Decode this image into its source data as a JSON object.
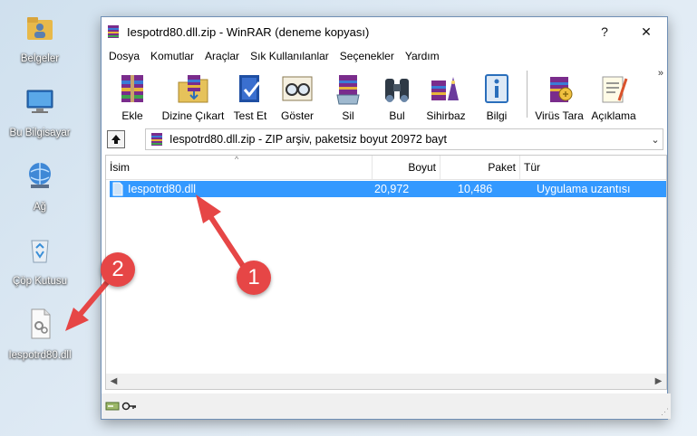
{
  "desktop": {
    "icons": [
      {
        "label": "Belgeler"
      },
      {
        "label": "Bu Bilgisayar"
      },
      {
        "label": "Ağ"
      },
      {
        "label": "Çöp Kutusu"
      },
      {
        "label": "Iespotrd80.dll"
      }
    ]
  },
  "window": {
    "title": "Iespotrd80.dll.zip - WinRAR (deneme kopyası)",
    "help_label": "?",
    "close_label": "✕"
  },
  "menu": [
    "Dosya",
    "Komutlar",
    "Araçlar",
    "Sık Kullanılanlar",
    "Seçenekler",
    "Yardım"
  ],
  "toolbar": {
    "buttons": [
      {
        "label": "Ekle",
        "icon": "add-archive-icon"
      },
      {
        "label": "Dizine Çıkart",
        "icon": "extract-folder-icon"
      },
      {
        "label": "Test Et",
        "icon": "test-icon"
      },
      {
        "label": "Göster",
        "icon": "view-glasses-icon"
      },
      {
        "label": "Sil",
        "icon": "delete-icon"
      },
      {
        "label": "Bul",
        "icon": "find-binoculars-icon"
      },
      {
        "label": "Sihirbaz",
        "icon": "wizard-icon"
      },
      {
        "label": "Bilgi",
        "icon": "info-icon"
      },
      {
        "label": "Virüs Tara",
        "icon": "virus-scan-icon"
      },
      {
        "label": "Açıklama",
        "icon": "comment-icon"
      }
    ],
    "more": "»"
  },
  "address": {
    "text": "Iespotrd80.dll.zip - ZIP arşiv, paketsiz boyut 20972 bayt"
  },
  "list": {
    "columns": [
      "İsim",
      "Boyut",
      "Paket",
      "Tür"
    ],
    "rows": [
      {
        "name": "Iespotrd80.dll",
        "size": "20,972",
        "packed": "10,486",
        "type": "Uygulama uzantısı"
      }
    ]
  },
  "annotations": {
    "badge1": "1",
    "badge2": "2",
    "color": "#e64646"
  }
}
